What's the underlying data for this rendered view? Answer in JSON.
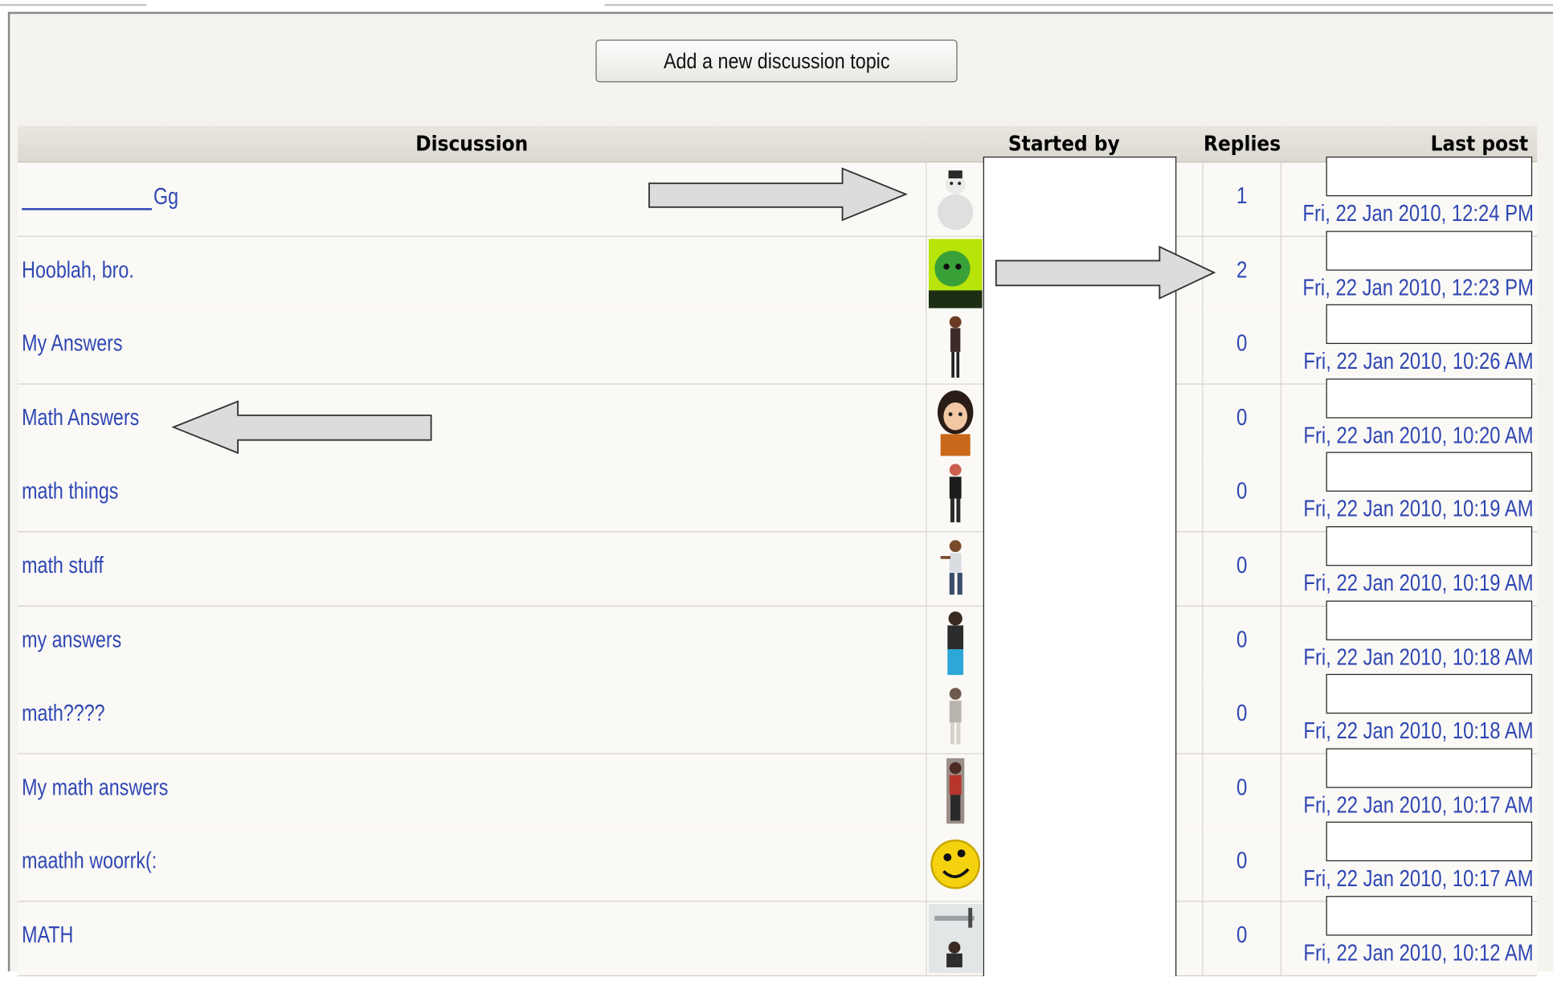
{
  "toolbar": {
    "add_topic_label": "Add a new discussion topic"
  },
  "table": {
    "headers": {
      "discussion": "Discussion",
      "started_by": "Started by",
      "replies": "Replies",
      "last_post": "Last post"
    },
    "rows": [
      {
        "topic": "Gg",
        "topic_blank_prefix": true,
        "avatar": "snowman-avatar",
        "replies": "1",
        "last_post": "Fri, 22 Jan 2010, 12:24 PM"
      },
      {
        "topic": "Hooblah, bro.",
        "avatar": "green-face-avatar",
        "replies": "2",
        "last_post": "Fri, 22 Jan 2010, 12:23 PM"
      },
      {
        "topic": "My Answers",
        "avatar": "girl-figure-avatar",
        "replies": "0",
        "last_post": "Fri, 22 Jan 2010, 10:26 AM"
      },
      {
        "topic": "Math Answers",
        "avatar": "cartoon-girl-avatar",
        "replies": "0",
        "last_post": "Fri, 22 Jan 2010, 10:20 AM"
      },
      {
        "topic": "math things",
        "avatar": "figure-black-avatar",
        "replies": "0",
        "last_post": "Fri, 22 Jan 2010, 10:19 AM"
      },
      {
        "topic": "math stuff",
        "avatar": "dancing-figure-avatar",
        "replies": "0",
        "last_post": "Fri, 22 Jan 2010, 10:19 AM"
      },
      {
        "topic": "my answers",
        "avatar": "figure-blue-avatar",
        "replies": "0",
        "last_post": "Fri, 22 Jan 2010, 10:18 AM"
      },
      {
        "topic": "math????",
        "avatar": "figure-pale-avatar",
        "replies": "0",
        "last_post": "Fri, 22 Jan 2010, 10:18 AM"
      },
      {
        "topic": "My math answers",
        "avatar": "figure-red-avatar",
        "replies": "0",
        "last_post": "Fri, 22 Jan 2010, 10:17 AM"
      },
      {
        "topic": "maathh woorrk(:",
        "avatar": "smiley-avatar",
        "replies": "0",
        "last_post": "Fri, 22 Jan 2010, 10:17 AM"
      },
      {
        "topic": "MATH",
        "avatar": "snow-scene-avatar",
        "replies": "0",
        "last_post": "Fri, 22 Jan 2010, 10:12 AM"
      }
    ]
  },
  "annotations": [
    {
      "name": "arrow-right-to-avatar",
      "direction": "right"
    },
    {
      "name": "arrow-right-to-replies",
      "direction": "right"
    },
    {
      "name": "arrow-left-to-topic",
      "direction": "left"
    }
  ],
  "colors": {
    "link": "#2f47b3",
    "panel_bg": "#f5f3ee",
    "header_bg": "#dcd9d0",
    "arrow_fill": "#dcdcdc"
  }
}
